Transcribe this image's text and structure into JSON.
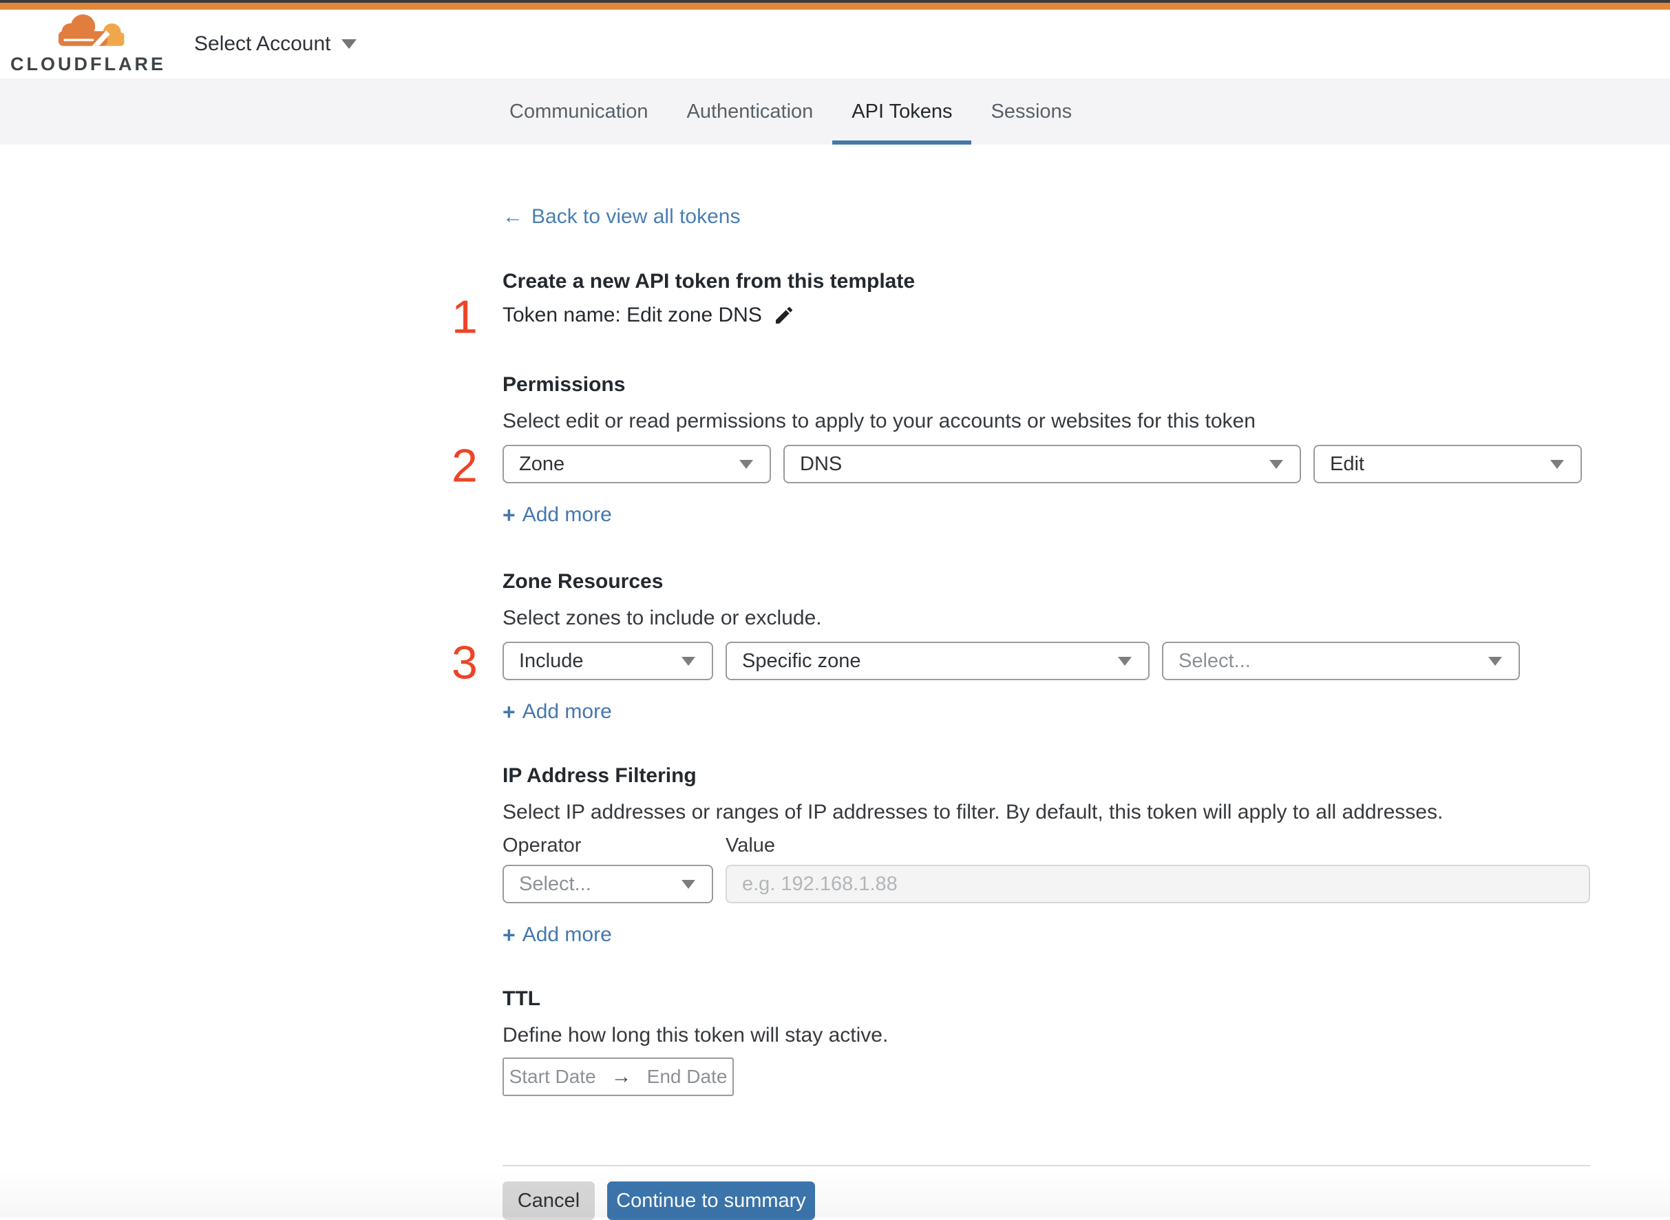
{
  "colors": {
    "top_stripe_orange": "#e0883a",
    "top_stripe_dark": "#3b3b3b",
    "tab_underline_blue": "#4478ab",
    "link_blue": "#4a7eb3",
    "step_number_red": "#ee4426",
    "logo_orange": "#e17d3e",
    "logo_light_orange": "#f0a74c",
    "continue_button_blue": "#3c76ad",
    "cancel_button_gray": "#d8d8d8",
    "tabbar_gray": "#f4f4f6"
  },
  "header": {
    "brand": "CLOUDFLARE",
    "account_selector": "Select Account"
  },
  "tabs": [
    {
      "label": "Communication",
      "active": false
    },
    {
      "label": "Authentication",
      "active": false
    },
    {
      "label": "API Tokens",
      "active": true
    },
    {
      "label": "Sessions",
      "active": false
    }
  ],
  "page": {
    "back_arrow": "←",
    "back_link": "Back to view all tokens",
    "template_heading": "Create a new API token from this template",
    "token_name_line": "Token name: Edit zone DNS",
    "step1": "1",
    "step2": "2",
    "step3": "3"
  },
  "permissions": {
    "title": "Permissions",
    "description": "Select edit or read permissions to apply to your accounts or websites for this token",
    "scope_value": "Zone",
    "resource_value": "DNS",
    "access_value": "Edit",
    "add_more_plus": "+",
    "add_more_label": "Add more"
  },
  "zone_resources": {
    "title": "Zone Resources",
    "description": "Select zones to include or exclude.",
    "mode_value": "Include",
    "type_value": "Specific zone",
    "zone_placeholder": "Select...",
    "add_more_plus": "+",
    "add_more_label": "Add more"
  },
  "ip_filtering": {
    "title": "IP Address Filtering",
    "description": "Select IP addresses or ranges of IP addresses to filter. By default, this token will apply to all addresses.",
    "operator_label": "Operator",
    "value_label": "Value",
    "operator_placeholder": "Select...",
    "value_placeholder": "e.g. 192.168.1.88",
    "add_more_plus": "+",
    "add_more_label": "Add more"
  },
  "ttl": {
    "title": "TTL",
    "description": "Define how long this token will stay active.",
    "start_label": "Start Date",
    "range_arrow": "→",
    "end_label": "End Date"
  },
  "actions": {
    "cancel": "Cancel",
    "continue": "Continue to summary"
  }
}
